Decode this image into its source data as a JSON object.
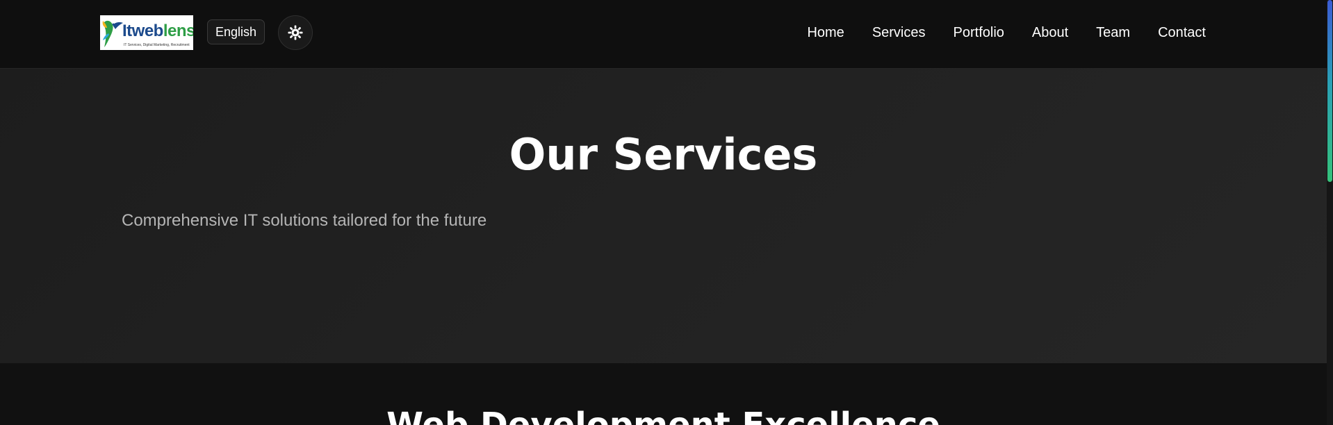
{
  "header": {
    "logo": {
      "text_main": "Itweb",
      "text_accent": "lens",
      "tagline": "IT Services, Digital Marketing, Recruitment"
    },
    "language_label": "English",
    "theme_icon": "sun-icon",
    "nav": [
      {
        "label": "Home"
      },
      {
        "label": "Services"
      },
      {
        "label": "Portfolio"
      },
      {
        "label": "About"
      },
      {
        "label": "Team"
      },
      {
        "label": "Contact"
      }
    ]
  },
  "hero": {
    "title": "Our Services",
    "subtitle": "Comprehensive IT solutions tailored for the future"
  },
  "next_section": {
    "heading": "Web Development Excellence"
  },
  "colors": {
    "background": "#111111",
    "hero_background": "#222222",
    "text": "#ffffff",
    "muted_text": "#b5b5b5",
    "scroll_gradient": [
      "#3b5bd4",
      "#2aa0b6",
      "#35c27a"
    ]
  }
}
